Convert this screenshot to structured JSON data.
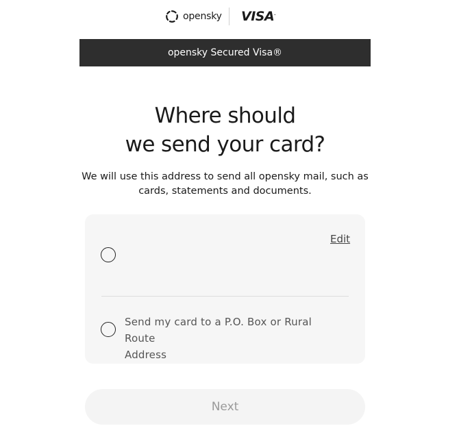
{
  "header": {
    "brand_name": "opensky",
    "partner_logo": "VISA",
    "partner_logo_mark": "."
  },
  "banner": {
    "text": "opensky Secured Visa®"
  },
  "main": {
    "title_line1": "Where should",
    "title_line2": "we send your card?",
    "description_line1": "We will use this address to send all opensky mail, such as",
    "description_line2": "cards, statements and documents."
  },
  "address_options": {
    "edit_label": "Edit",
    "home_address": {
      "selected": false
    },
    "pobox_option": {
      "label_line1": "Send my card to a P.O. Box or Rural Route",
      "label_line2": "Address",
      "selected": false
    }
  },
  "footer": {
    "next_label": "Next",
    "next_enabled": false
  },
  "icons": {
    "brand_mark": "opensky-sun-icon",
    "radio": "radio-empty-icon"
  },
  "colors": {
    "banner_bg": "#2e2e2e",
    "card_bg": "#f6f6f6",
    "button_disabled_bg": "#f4f4f4",
    "button_disabled_text": "#9a9a9a",
    "text_primary": "#1a1a1a"
  }
}
